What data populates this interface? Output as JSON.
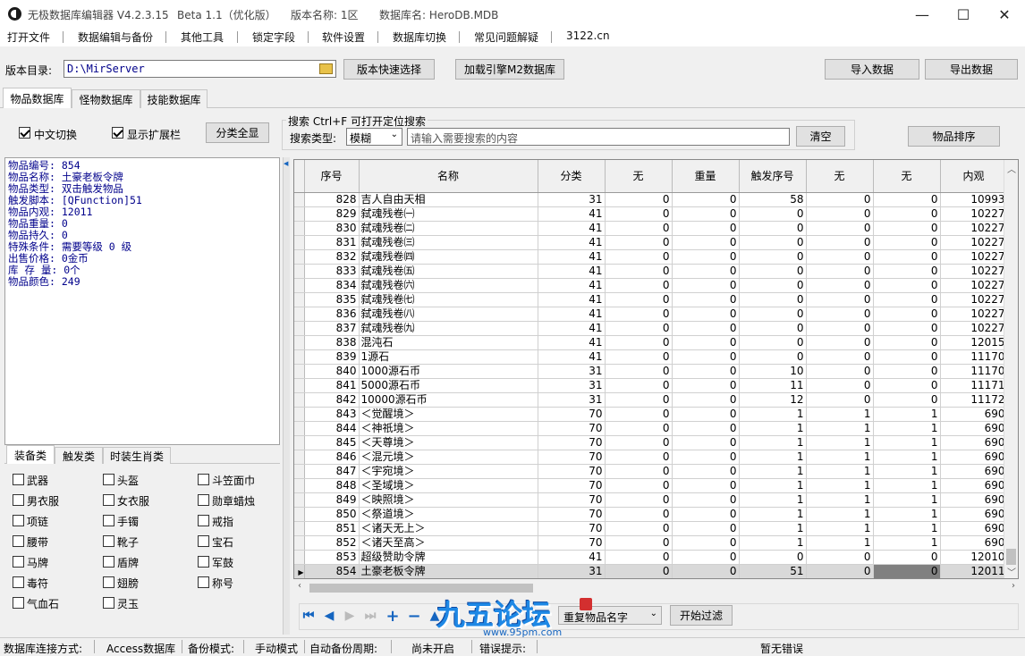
{
  "window": {
    "title": "无极数据库编辑器 V4.2.3.15",
    "beta": "Beta 1.1（优化版）",
    "version_name": "版本名称: 1区",
    "db_name": "数据库名: HeroDB.MDB"
  },
  "menu": [
    "打开文件",
    "数据编辑与备份",
    "其他工具",
    "锁定字段",
    "软件设置",
    "数据库切换",
    "常见问题解疑",
    "3122.cn"
  ],
  "toolbar": {
    "dir_label": "版本目录:",
    "dir_value": "D:\\MirServer",
    "quick_select": "版本快速选择",
    "load_m2": "加载引擎M2数据库",
    "import": "导入数据",
    "export": "导出数据"
  },
  "tabs": [
    "物品数据库",
    "怪物数据库",
    "技能数据库"
  ],
  "filters": {
    "chinese": "中文切换",
    "ext": "显示扩展栏",
    "show_all": "分类全显",
    "search_title": "搜索   Ctrl+F 可打开定位搜索",
    "search_type_label": "搜索类型:",
    "search_type": "模糊",
    "search_placeholder": "请输入需要搜索的内容",
    "clear": "清空",
    "sort": "物品排序"
  },
  "info": [
    "物品编号: 854",
    "物品名称: 土豪老板令牌",
    "物品类型: 双击触发物品",
    "触发脚本: [QFunction]51",
    "物品内观: 12011",
    "物品重量: 0",
    "物品持久: 0",
    "特殊条件: 需要等级 0 级",
    "出售价格: 0金币",
    "库 存 量: 0个",
    "物品颜色: 249"
  ],
  "cat_tabs": [
    "装备类",
    "触发类",
    "时装生肖类"
  ],
  "categories": [
    "武器",
    "头盔",
    "斗笠面巾",
    "男衣服",
    "女衣服",
    "勋章蜡烛",
    "项链",
    "手镯",
    "戒指",
    "腰带",
    "靴子",
    "宝石",
    "马牌",
    "盾牌",
    "军鼓",
    "毒符",
    "翅膀",
    "称号",
    "气血石",
    "灵玉"
  ],
  "table": {
    "headers": [
      "序号",
      "名称",
      "分类",
      "无",
      "重量",
      "触发序号",
      "无",
      "无",
      "内观"
    ],
    "rows": [
      [
        "828",
        "吉人自由天相",
        "31",
        "0",
        "0",
        "58",
        "0",
        "0",
        "10993"
      ],
      [
        "829",
        "弑魂残卷㈠",
        "41",
        "0",
        "0",
        "0",
        "0",
        "0",
        "10227"
      ],
      [
        "830",
        "弑魂残卷㈡",
        "41",
        "0",
        "0",
        "0",
        "0",
        "0",
        "10227"
      ],
      [
        "831",
        "弑魂残卷㈢",
        "41",
        "0",
        "0",
        "0",
        "0",
        "0",
        "10227"
      ],
      [
        "832",
        "弑魂残卷㈣",
        "41",
        "0",
        "0",
        "0",
        "0",
        "0",
        "10227"
      ],
      [
        "833",
        "弑魂残卷㈤",
        "41",
        "0",
        "0",
        "0",
        "0",
        "0",
        "10227"
      ],
      [
        "834",
        "弑魂残卷㈥",
        "41",
        "0",
        "0",
        "0",
        "0",
        "0",
        "10227"
      ],
      [
        "835",
        "弑魂残卷㈦",
        "41",
        "0",
        "0",
        "0",
        "0",
        "0",
        "10227"
      ],
      [
        "836",
        "弑魂残卷㈧",
        "41",
        "0",
        "0",
        "0",
        "0",
        "0",
        "10227"
      ],
      [
        "837",
        "弑魂残卷㈨",
        "41",
        "0",
        "0",
        "0",
        "0",
        "0",
        "10227"
      ],
      [
        "838",
        "混沌石",
        "41",
        "0",
        "0",
        "0",
        "0",
        "0",
        "12015"
      ],
      [
        "839",
        "1源石",
        "41",
        "0",
        "0",
        "0",
        "0",
        "0",
        "11170"
      ],
      [
        "840",
        "1000源石币",
        "31",
        "0",
        "0",
        "10",
        "0",
        "0",
        "11170"
      ],
      [
        "841",
        "5000源石币",
        "31",
        "0",
        "0",
        "11",
        "0",
        "0",
        "11171"
      ],
      [
        "842",
        "10000源石币",
        "31",
        "0",
        "0",
        "12",
        "0",
        "0",
        "11172"
      ],
      [
        "843",
        "＜觉醒境＞",
        "70",
        "0",
        "0",
        "1",
        "1",
        "1",
        "690"
      ],
      [
        "844",
        "＜神祇境＞",
        "70",
        "0",
        "0",
        "1",
        "1",
        "1",
        "690"
      ],
      [
        "845",
        "＜天尊境＞",
        "70",
        "0",
        "0",
        "1",
        "1",
        "1",
        "690"
      ],
      [
        "846",
        "＜混元境＞",
        "70",
        "0",
        "0",
        "1",
        "1",
        "1",
        "690"
      ],
      [
        "847",
        "＜宇宛境＞",
        "70",
        "0",
        "0",
        "1",
        "1",
        "1",
        "690"
      ],
      [
        "848",
        "＜圣域境＞",
        "70",
        "0",
        "0",
        "1",
        "1",
        "1",
        "690"
      ],
      [
        "849",
        "＜映照境＞",
        "70",
        "0",
        "0",
        "1",
        "1",
        "1",
        "690"
      ],
      [
        "850",
        "＜祭道境＞",
        "70",
        "0",
        "0",
        "1",
        "1",
        "1",
        "690"
      ],
      [
        "851",
        "＜诸天无上＞",
        "70",
        "0",
        "0",
        "1",
        "1",
        "1",
        "690"
      ],
      [
        "852",
        "＜诸天至高＞",
        "70",
        "0",
        "0",
        "1",
        "1",
        "1",
        "690"
      ],
      [
        "853",
        "超级赞助令牌",
        "41",
        "0",
        "0",
        "0",
        "0",
        "0",
        "12010"
      ],
      [
        "854",
        "土豪老板令牌",
        "31",
        "0",
        "0",
        "51",
        "0",
        "0",
        "12011"
      ]
    ]
  },
  "bottom": {
    "filter_field": "重复物品名字",
    "start_filter": "开始过滤"
  },
  "watermark": {
    "text": "九五论坛",
    "url": "www.95pm.com"
  },
  "status": [
    "数据库连接方式:",
    "Access数据库",
    "备份模式:",
    "手动模式",
    "自动备份周期:",
    "尚未开启",
    "错误提示:",
    "暂无错误"
  ]
}
